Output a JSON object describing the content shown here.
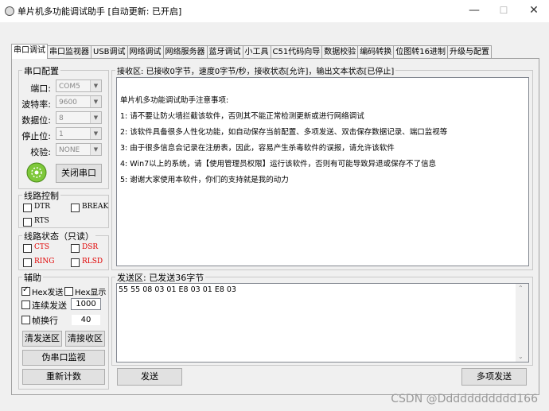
{
  "window": {
    "title": "单片机多功能调试助手 [自动更新: 已开启]",
    "min_label": "—",
    "max_label": "☐",
    "close_label": "✕"
  },
  "tabs": [
    "串口调试",
    "串口监视器",
    "USB调试",
    "网络调试",
    "网络服务器",
    "蓝牙调试",
    "小工具",
    "C51代码向导",
    "数据校验",
    "编码转换",
    "位图转16进制",
    "升级与配置"
  ],
  "serial_config": {
    "title": "串口配置",
    "port_label": "端口:",
    "port_value": "COM5",
    "baud_label": "波特率:",
    "baud_value": "9600",
    "databits_label": "数据位:",
    "databits_value": "8",
    "stopbits_label": "停止位:",
    "stopbits_value": "1",
    "parity_label": "校验:",
    "parity_value": "NONE",
    "close_port_label": "关闭串口"
  },
  "line_control": {
    "title": "线路控制",
    "dtr": "DTR",
    "brk": "BREAK",
    "rts": "RTS"
  },
  "line_status": {
    "title": "线路状态（只读）",
    "cts": "CTS",
    "dsr": "DSR",
    "ring": "RING",
    "rlsd": "RLSD"
  },
  "aux": {
    "title": "辅助",
    "hex_send": "Hex发送",
    "hex_show": "Hex显示",
    "continuous_send": "连续发送",
    "interval_value": "1000",
    "frame_newline": "帧换行",
    "frame_value": "40",
    "clear_send": "清发送区",
    "clear_recv": "清接收区",
    "pseudo_monitor": "伪串口监视",
    "recount": "重新计数"
  },
  "receive": {
    "title": "接收区: 已接收0字节，速度0字节/秒，接收状态[允许]，输出文本状态[已停止]",
    "lines": [
      "单片机多功能调试助手注意事项:",
      "1: 请不要让防火墙拦截该软件，否则其不能正常检测更新或进行网络调试",
      "2: 该软件具备很多人性化功能，如自动保存当前配置、多项发送、双击保存数据记录、端口监视等",
      "3: 由于很多信息会记录在注册表，因此，容易产生杀毒软件的误报，请允许该软件",
      "4: Win7以上的系统，请【使用管理员权限】运行该软件，否则有可能导致异退或保存不了信息",
      "5: 谢谢大家使用本软件，你们的支持就是我的动力"
    ]
  },
  "send": {
    "title": "发送区: 已发送36字节",
    "content": "55 55 08 03 01 E8 03 01 E8 03",
    "send_button": "发送",
    "multi_send_button": "多项发送"
  },
  "watermark": "CSDN @Ddddddddddd166"
}
